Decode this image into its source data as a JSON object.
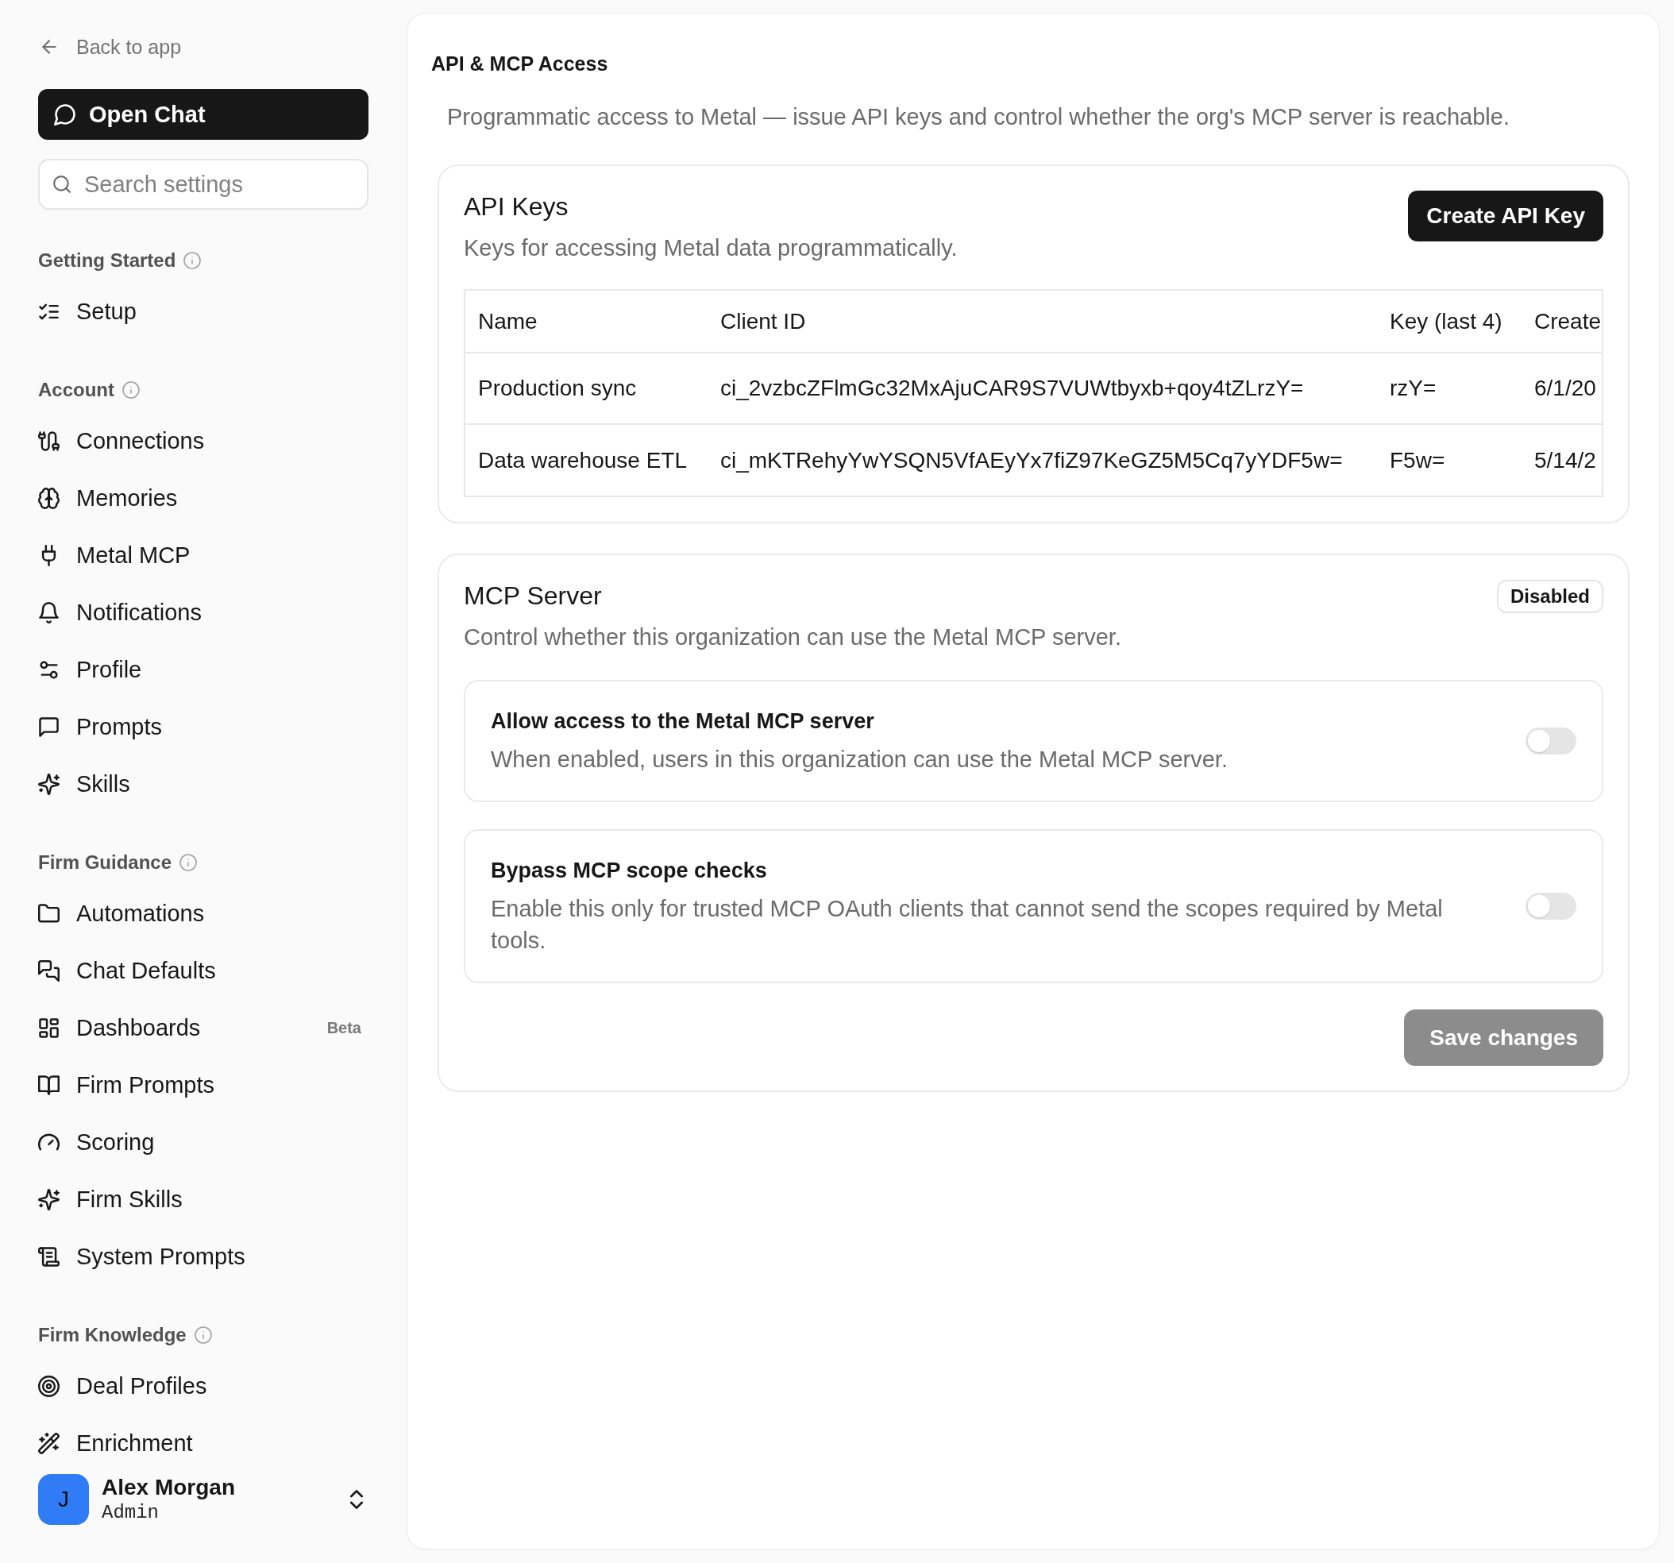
{
  "sidebar": {
    "back_link": "Back to app",
    "open_chat_button": "Open Chat",
    "search": {
      "placeholder": "Search settings"
    },
    "sections": [
      {
        "title": "Getting Started",
        "items": [
          {
            "label": "Setup",
            "selected": false
          }
        ]
      },
      {
        "title": "Account",
        "items": [
          {
            "label": "Connections",
            "selected": false
          },
          {
            "label": "Memories",
            "selected": false
          },
          {
            "label": "Metal MCP",
            "selected": false
          },
          {
            "label": "Notifications",
            "selected": false
          },
          {
            "label": "Profile",
            "selected": false
          },
          {
            "label": "Prompts",
            "selected": false
          },
          {
            "label": "Skills",
            "selected": false
          }
        ]
      },
      {
        "title": "Firm Guidance",
        "items": [
          {
            "label": "Automations",
            "selected": false
          },
          {
            "label": "Chat Defaults",
            "selected": false
          },
          {
            "label": "Dashboards",
            "badge": "Beta",
            "selected": false
          },
          {
            "label": "Firm Prompts",
            "selected": false
          },
          {
            "label": "Scoring",
            "selected": false
          },
          {
            "label": "Firm Skills",
            "selected": false
          },
          {
            "label": "System Prompts",
            "selected": false
          }
        ]
      },
      {
        "title": "Firm Knowledge",
        "items": [
          {
            "label": "Deal Profiles",
            "selected": false
          },
          {
            "label": "Enrichment",
            "selected": false
          }
        ]
      }
    ],
    "user": {
      "avatar_initial": "J",
      "name": "Alex Morgan",
      "role": "Admin"
    }
  },
  "page": {
    "title": "API & MCP Access",
    "description": "Programmatic access to Metal — issue API keys and control whether the org's MCP server is reachable."
  },
  "api_keys": {
    "title": "API Keys",
    "description": "Keys for accessing Metal data programmatically.",
    "create_button": "Create API Key",
    "table": {
      "columns": [
        "Name",
        "Client ID",
        "Key (last 4)",
        "Create"
      ],
      "rows": [
        [
          "Production sync",
          "ci_2vzbcZFlmGc32MxAjuCAR9S7VUWtbyxb+qoy4tZLrzY=",
          "rzY=",
          "6/1/20"
        ],
        [
          "Data warehouse ETL",
          "ci_mKTRehyYwYSQN5VfAEyYx7fiZ97KeGZ5M5Cq7yYDF5w=",
          "F5w=",
          "5/14/2"
        ]
      ]
    }
  },
  "mcp_server": {
    "title": "MCP Server",
    "status": "Disabled",
    "description": "Control whether this organization can use the Metal MCP server.",
    "settings": [
      {
        "title": "Allow access to the Metal MCP server",
        "description": "When enabled, users in this organization can use the Metal MCP server.",
        "on": false
      },
      {
        "title": "Bypass MCP scope checks",
        "description": "Enable this only for trusted MCP OAuth clients that cannot send the scopes required by Metal tools.",
        "on": false
      }
    ],
    "save_button": {
      "label": "Save changes",
      "disabled": true
    }
  }
}
